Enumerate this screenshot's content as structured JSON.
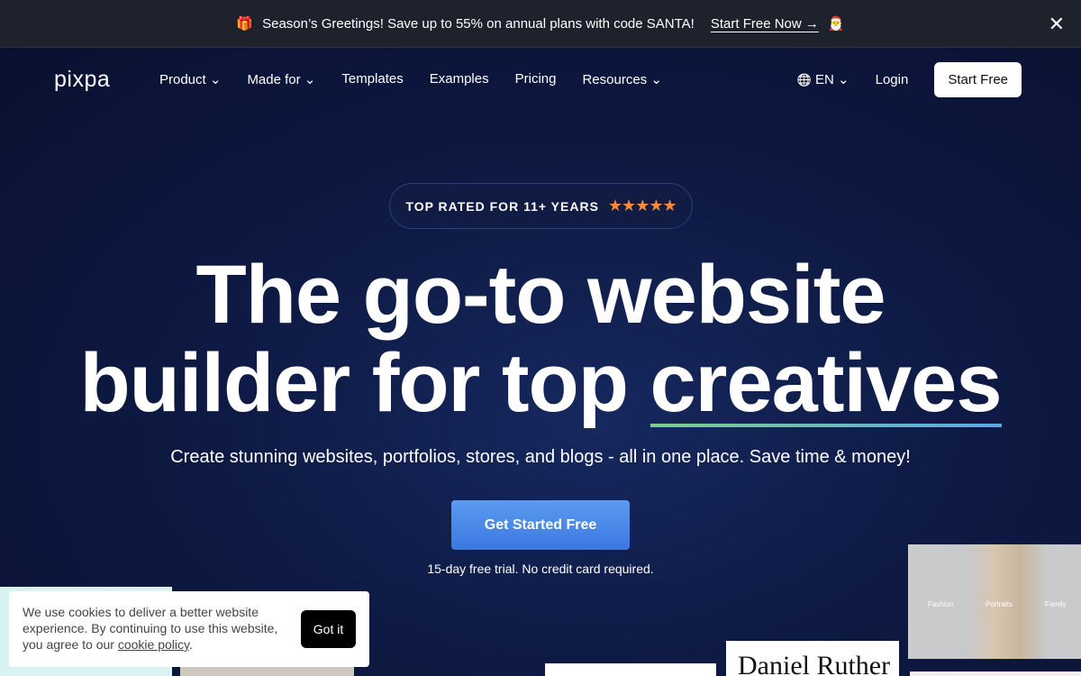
{
  "promo": {
    "gift_icon": "🎁",
    "text": "Season’s Greetings! Save up to 55% on annual plans with code SANTA!",
    "link": "Start Free Now →",
    "santa_icon": "🎅",
    "close": "✕"
  },
  "nav": {
    "logo": "pixpa",
    "items": [
      "Product ⌄",
      "Made for ⌄",
      "Templates",
      "Examples",
      "Pricing",
      "Resources ⌄"
    ],
    "language": "EN ⌄",
    "globe_icon": "🌐",
    "login": "Login",
    "start": "Start Free"
  },
  "hero": {
    "badge": "TOP RATED FOR 11+ YEARS",
    "stars": "★★★★★",
    "rating_stars": 5,
    "title_line1": "The go-to website",
    "title_line2a": "builder for top ",
    "title_line2b": "creatives",
    "subtitle": "Create stunning websites, portfolios, stores, and blogs - all in one place. Save time & money!",
    "cta": "Get Started Free",
    "trial": "15-day free trial. No credit card required."
  },
  "thumbs": {
    "name": "Daniel Ruther",
    "photo_labels": [
      "Fashion",
      "Portraits",
      "Family"
    ]
  },
  "cookie": {
    "text": "We use cookies to deliver a better website experience. By continuing to use this website, you agree to our ",
    "link": "cookie policy",
    "end": ".",
    "button": "Got it"
  },
  "colors": {
    "accent": "#3b78e0",
    "star": "#f58b3c"
  }
}
